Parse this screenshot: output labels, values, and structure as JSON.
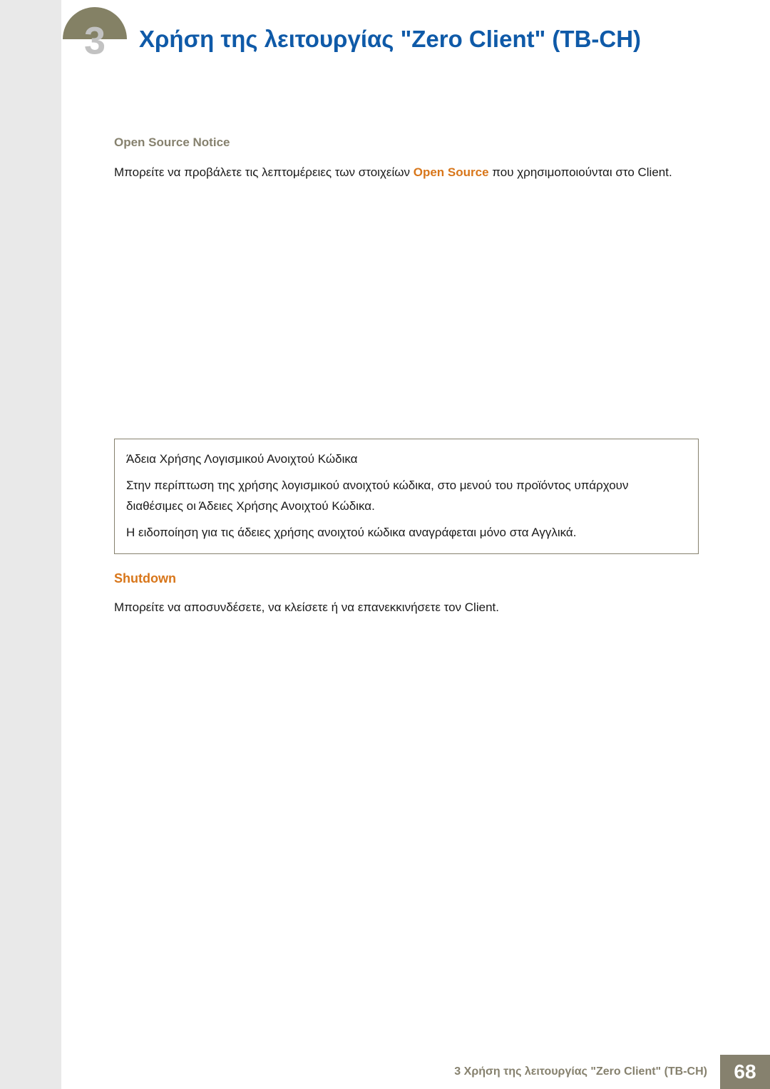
{
  "header": {
    "chapter_number": "3",
    "title": "Χρήση της λειτουργίας \"Zero Client\" (TB-CH)"
  },
  "content": {
    "open_source_heading": "Open Source Notice",
    "open_source_text_1": "Μπορείτε να προβάλετε τις λεπτομέρειες των στοιχείων ",
    "open_source_highlight": "Open Source",
    "open_source_text_2": " που χρησιμοποιούνται στο Client.",
    "info_box": {
      "line1": "Άδεια Χρήσης Λογισμικού Ανοιχτού Κώδικα",
      "line2": "Στην περίπτωση της χρήσης λογισμικού ανοιχτού κώδικα, στο μενού του προϊόντος υπάρχουν διαθέσιμες οι Άδειες Χρήσης Ανοιχτού Κώδικα.",
      "line3": "Η ειδοποίηση για τις άδειες χρήσης ανοιχτού κώδικα αναγράφεται μόνο στα Αγγλικά."
    },
    "shutdown_heading": "Shutdown",
    "shutdown_text": "Μπορείτε να αποσυνδέσετε, να κλείσετε ή να επανεκκινήσετε τον Client."
  },
  "footer": {
    "label": "3 Χρήση της λειτουργίας \"Zero Client\" (TB-CH)",
    "page_number": "68"
  }
}
